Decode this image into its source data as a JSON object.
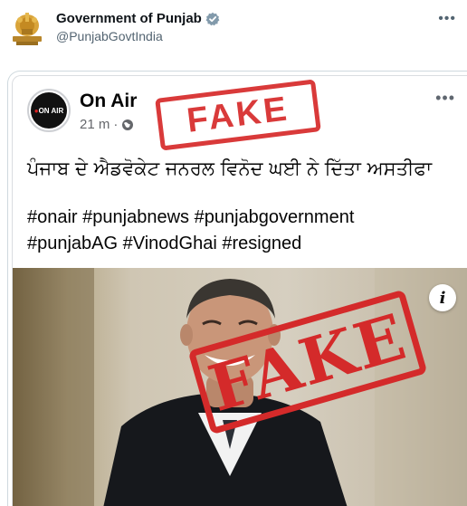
{
  "account": {
    "name": "Government of Punjab",
    "handle": "@PunjabGovtIndia",
    "verified_color": "#829aab",
    "more_icon": "more-horizontal-icon"
  },
  "embedded_post": {
    "page_name": "On Air",
    "avatar_text": "ON AIR",
    "time": "21 m",
    "separator": "·",
    "visibility_icon": "globe-icon",
    "more_icon": "more-horizontal-icon",
    "headline": "ਪੰਜਾਬ ਦੇ ਐਡਵੋਕੇਟ ਜਨਰਲ ਵਿਨੋਦ ਘਈ ਨੇ ਦਿੱਤਾ ਅਸਤੀਫਾ",
    "hashtags_line1": "#onair #punjabnews #punjabgovernment",
    "hashtags_line2": "#punjabAG #VinodGhai #resigned",
    "info_label": "i"
  },
  "stamps": {
    "top": "FAKE",
    "bottom": "FAKE",
    "color": "#d42a2a"
  }
}
